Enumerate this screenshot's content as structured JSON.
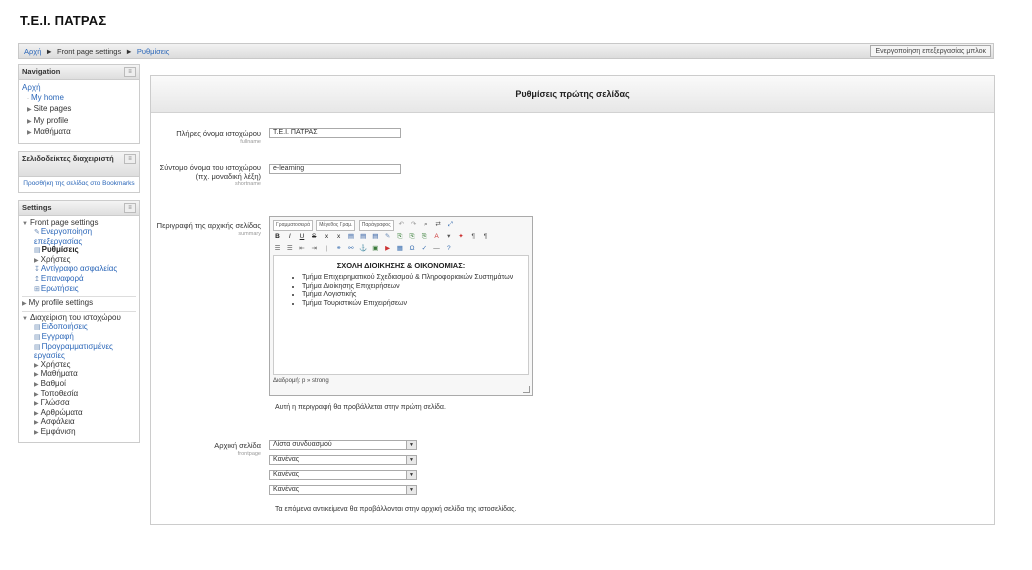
{
  "site": {
    "title": "Τ.Ε.Ι. ΠΑΤΡΑΣ"
  },
  "breadcrumb": {
    "items": [
      "Αρχή",
      "Front page settings",
      "Ρυθμίσεις"
    ],
    "separator": "►"
  },
  "header": {
    "edit_button": "Ενεργοποίηση επεξεργασίας μπλοκ"
  },
  "navigation": {
    "title": "Navigation",
    "home": "Αρχή",
    "items": [
      "My home",
      "Site pages",
      "My profile",
      "Μαθήματα"
    ]
  },
  "bookmarks": {
    "title": "Σελιδοδείκτες διαχειριστή",
    "link": "Προσθήκη της σελίδας στο Bookmarks"
  },
  "settings": {
    "title": "Settings",
    "front_page": "Front page settings",
    "front_items": [
      "Ενεργοποίηση επεξεργασίας",
      "Ρυθμίσεις",
      "Χρήστες",
      "Αντίγραφο ασφαλείας",
      "Επαναφορά",
      "Ερωτήσεις"
    ],
    "profile": "My profile settings",
    "admin": "Διαχείριση του ιστοχώρου",
    "admin_items": [
      "Ειδοποιήσεις",
      "Εγγραφή",
      "Προγραμματισμένες εργασίες"
    ],
    "admin_sub": [
      "Χρήστες",
      "Μαθήματα",
      "Βαθμοί",
      "Τοποθεσία",
      "Γλώσσα",
      "Αρθρώματα",
      "Ασφάλεια",
      "Εμφάνιση"
    ]
  },
  "main": {
    "heading": "Ρυθμίσεις πρώτης σελίδας",
    "fullname": {
      "label": "Πλήρες όνομα ιστοχώρου",
      "key": "fullname",
      "value": "Τ.Ε.Ι. ΠΑΤΡΑΣ"
    },
    "shortname": {
      "label": "Σύντομο όνομα του ιστοχώρου (πχ. μοναδική λέξη)",
      "key": "shortname",
      "value": "e-learning"
    },
    "summary": {
      "label": "Περιγραφή της αρχικής σελίδας",
      "key": "summary",
      "combos": [
        "Γραμματοσειρά",
        "Μέγεθος Γραμ.",
        "Παράγραφος"
      ],
      "heading": "ΣΧΟΛΗ ΔΙΟΙΚΗΣΗΣ & ΟΙΚΟΝΟΜΙΑΣ:",
      "bullets": [
        "Τμήμα Επιχειρηματικού Σχεδιασμού & Πληροφοριακών Συστημάτων",
        "Τμήμα Διοίκησης Επιχειρήσεων",
        "Τμήμα Λογιστικής",
        "Τμήμα Τουριστικών Επιχειρήσεων"
      ],
      "path": "Διαδρομή: p » strong",
      "note": "Αυτή η περιγραφή θα προβάλλεται στην πρώτη σελίδα."
    },
    "frontpage": {
      "label": "Αρχική σελίδα",
      "key": "frontpage",
      "options": [
        "Λίστα συνδυασμού",
        "Κανένας",
        "Κανένας",
        "Κανένας"
      ],
      "note": "Τα επόμενα αντικείμενα θα προβάλλονται στην αρχική σελίδα της ιστοσελίδας."
    }
  }
}
